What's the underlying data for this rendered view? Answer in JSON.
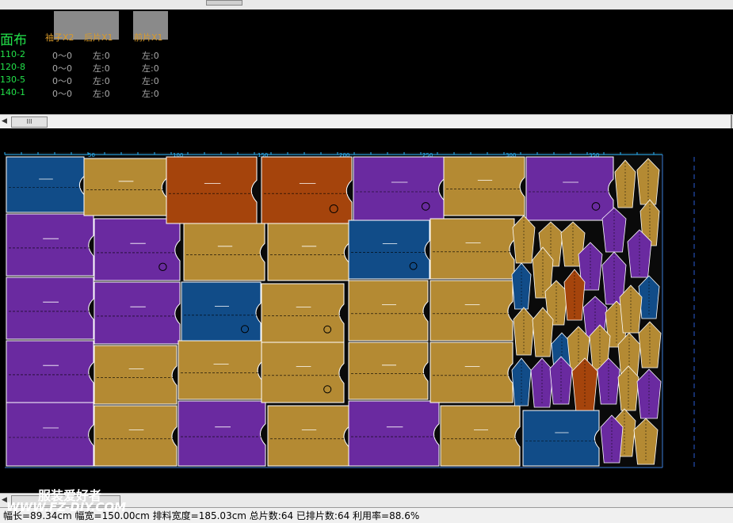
{
  "fabric": {
    "title": "面布"
  },
  "pieces": [
    {
      "label": "袖子X2"
    },
    {
      "label": "后片X1"
    },
    {
      "label": "前片X1"
    }
  ],
  "sizes": [
    {
      "size": "110-2",
      "v1": "0～0",
      "v2": "左:0",
      "v3": "左:0"
    },
    {
      "size": "120-8",
      "v1": "0～0",
      "v2": "左:0",
      "v3": "左:0"
    },
    {
      "size": "130-5",
      "v1": "0～0",
      "v2": "左:0",
      "v3": "左:0"
    },
    {
      "size": "140-1",
      "v1": "0～0",
      "v2": "左:0",
      "v3": "左:0"
    }
  ],
  "ruler": {
    "ticks": [
      "50",
      "100",
      "150",
      "200",
      "250",
      "300",
      "350"
    ]
  },
  "colors": {
    "purple": "#6a2aa0",
    "gold": "#b48a33",
    "blue": "#114c88",
    "rust": "#a5440c"
  },
  "status": {
    "text": "幅长=89.34cm 幅宽=150.00cm 排料宽度=185.03cm 总片数:64 已排片数:64 利用率=88.6%"
  },
  "watermark": {
    "line1": "服装爱好者",
    "line2": "WWW.FZ-DIY.COM"
  },
  "scroll": {
    "thumb_label": "III"
  }
}
